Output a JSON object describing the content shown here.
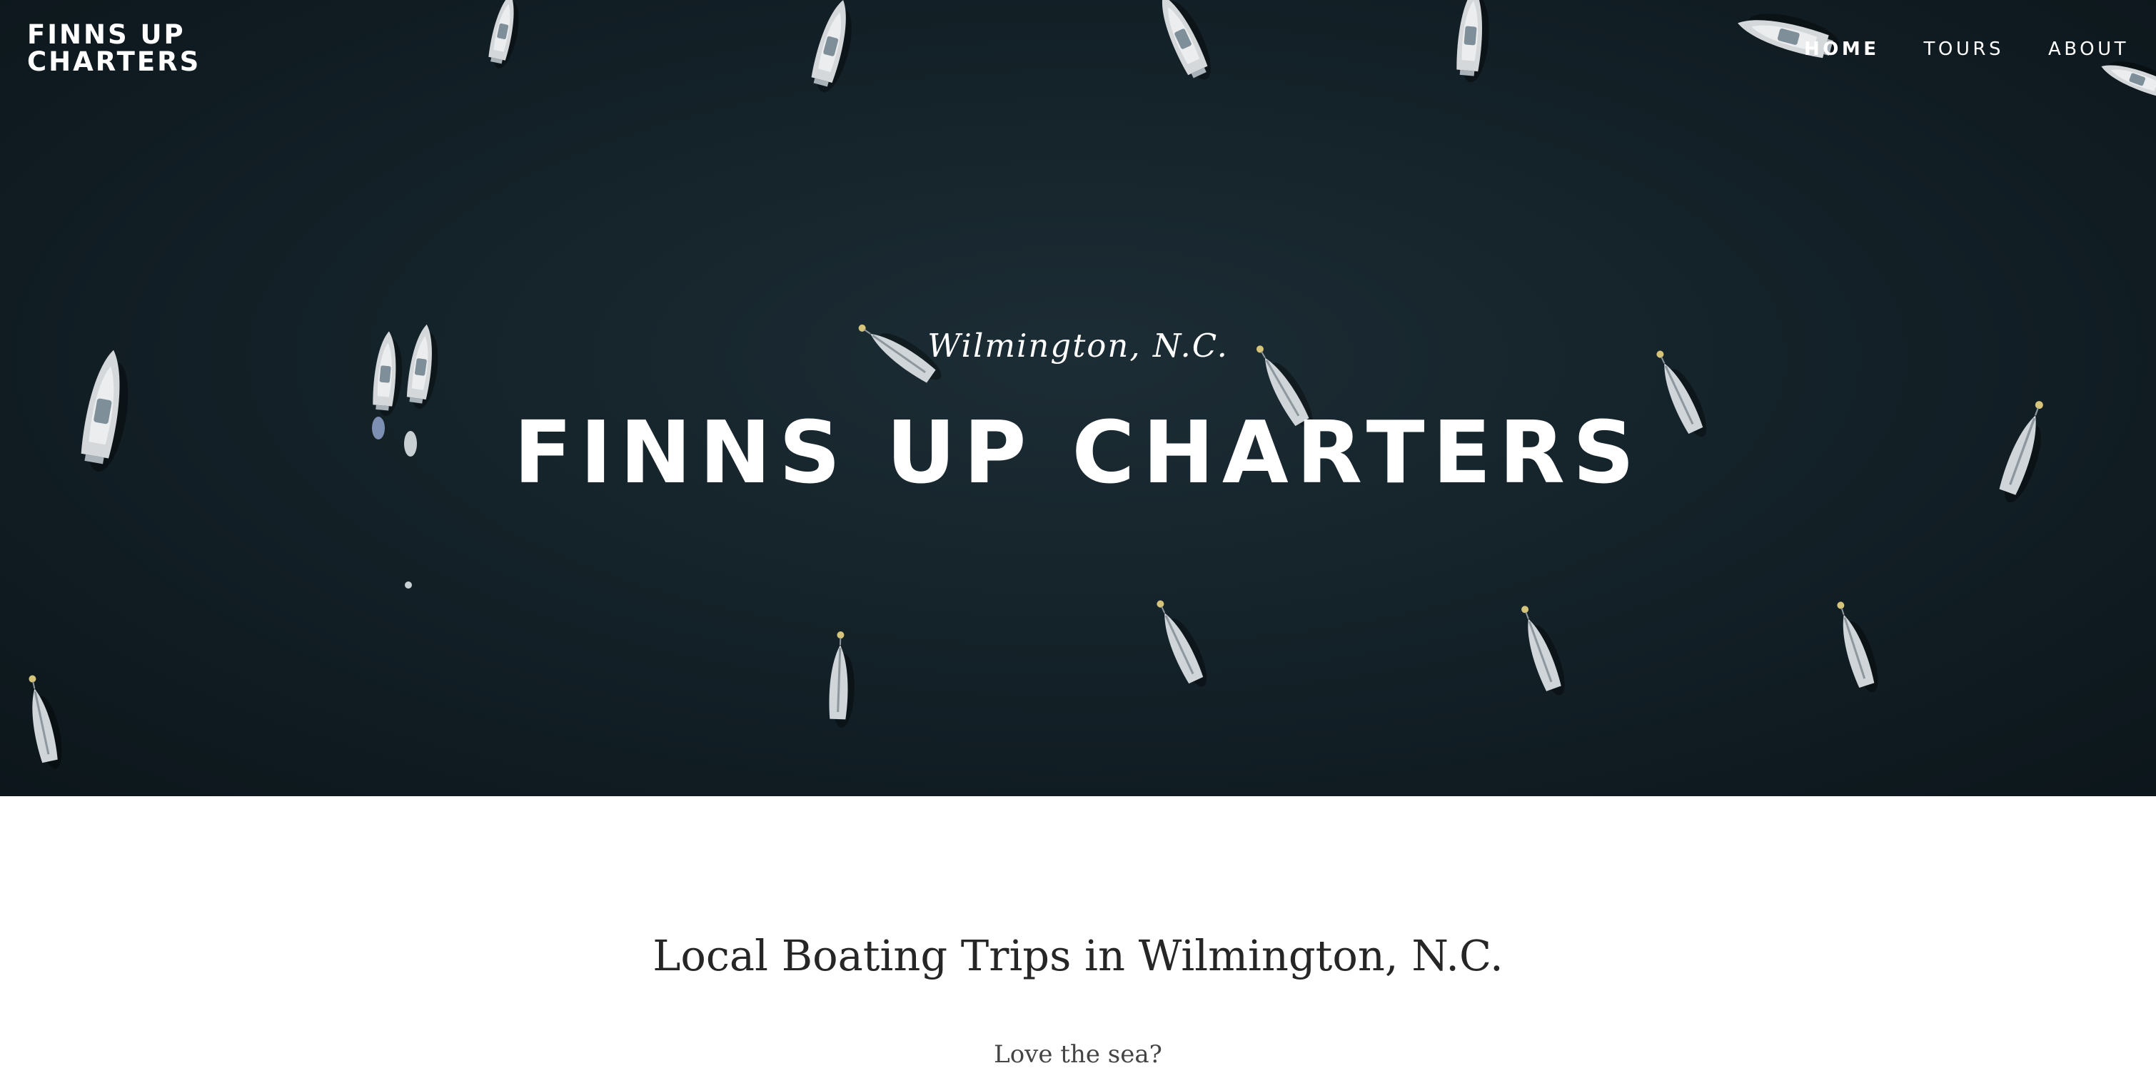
{
  "site": {
    "logo_line1": "FINNS UP",
    "logo_line2": "CHARTERS"
  },
  "nav": {
    "items": [
      {
        "label": "HOME",
        "active": true
      },
      {
        "label": "TOURS",
        "active": false
      },
      {
        "label": "ABOUT",
        "active": false
      }
    ]
  },
  "hero": {
    "subtitle": "Wilmington, N.C.",
    "title": "FINNS UP CHARTERS",
    "background": "aerial photo of moored boats on dark water"
  },
  "intro": {
    "heading": "Local Boating Trips in Wilmington, N.C.",
    "text": "Love the sea?"
  },
  "colors": {
    "water": "#142229",
    "text_light": "#ffffff",
    "heading_dark": "#262626",
    "body_text": "#444444"
  }
}
